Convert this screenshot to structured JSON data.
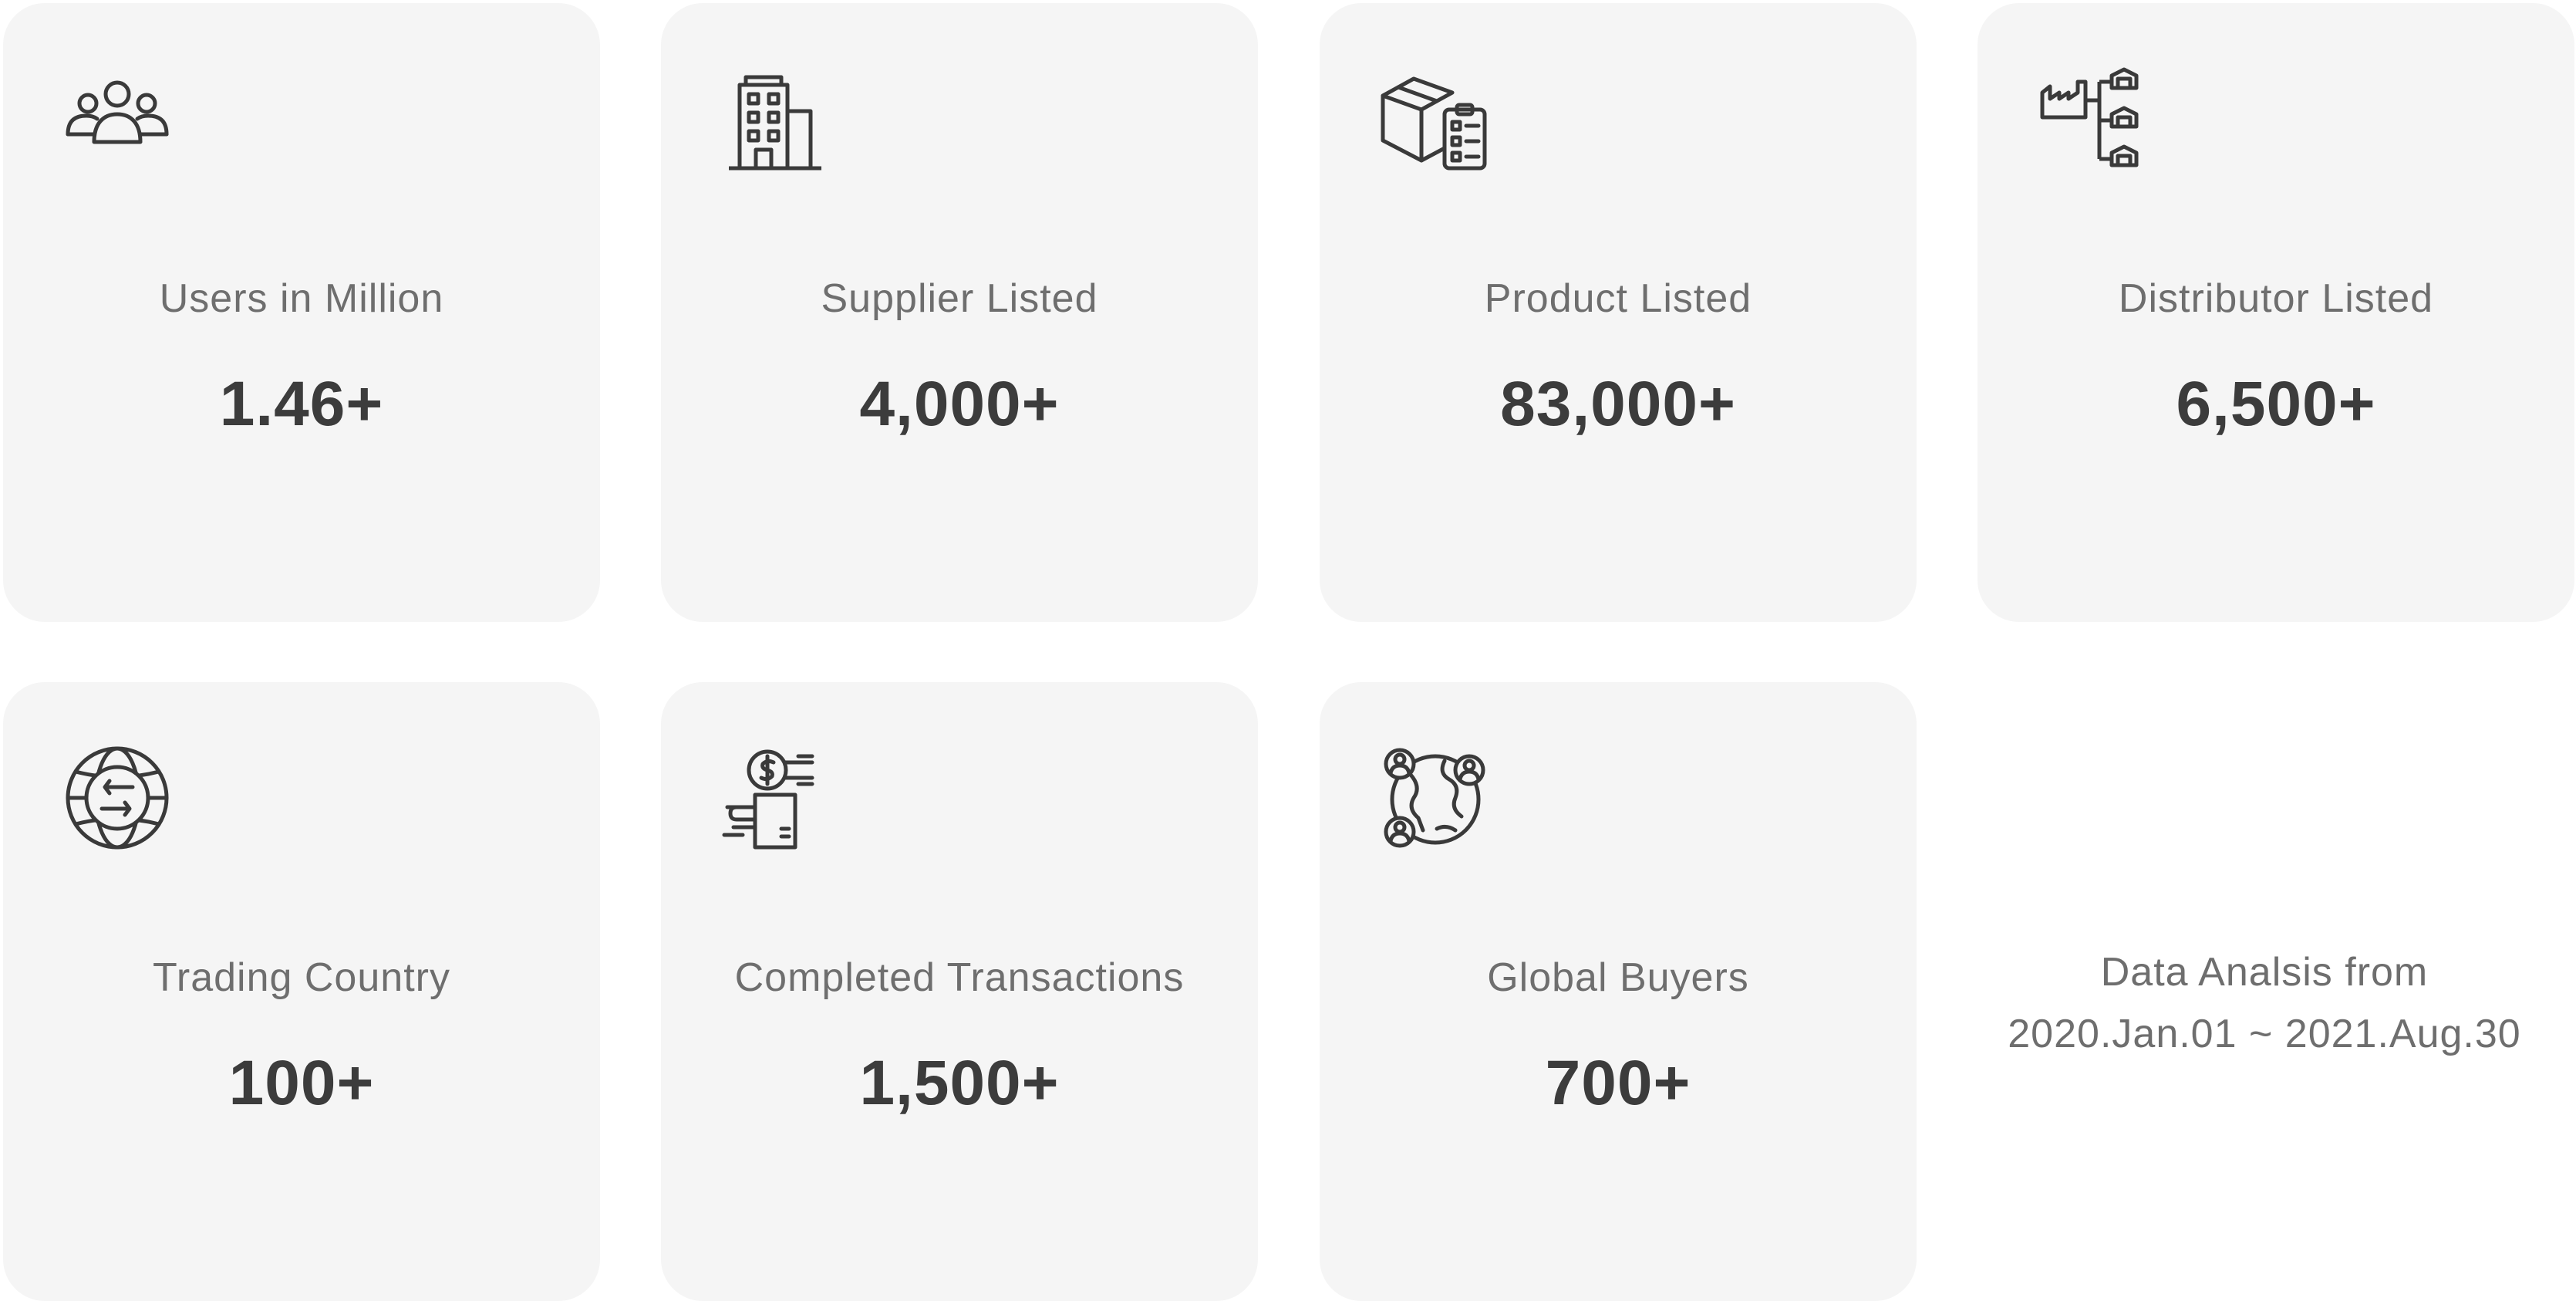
{
  "colors": {
    "card_background": "#f5f5f5",
    "label_text": "#6e6e6e",
    "value_text": "#3c3c3c",
    "icon_stroke": "#3a3a3a"
  },
  "stats": [
    {
      "label": "Users in Million",
      "value": "1.46+",
      "icon": "users-group-icon"
    },
    {
      "label": "Supplier Listed",
      "value": "4,000+",
      "icon": "building-icon"
    },
    {
      "label": "Product Listed",
      "value": "83,000+",
      "icon": "box-checklist-icon"
    },
    {
      "label": "Distributor Listed",
      "value": "6,500+",
      "icon": "factory-warehouses-icon"
    },
    {
      "label": "Trading Country",
      "value": "100+",
      "icon": "globe-exchange-icon"
    },
    {
      "label": "Completed Transactions",
      "value": "1,500+",
      "icon": "hand-money-icon"
    },
    {
      "label": "Global Buyers",
      "value": "700+",
      "icon": "global-buyers-icon"
    }
  ],
  "note": {
    "line1": "Data Analsis from",
    "line2": "2020.Jan.01 ~ 2021.Aug.30"
  }
}
